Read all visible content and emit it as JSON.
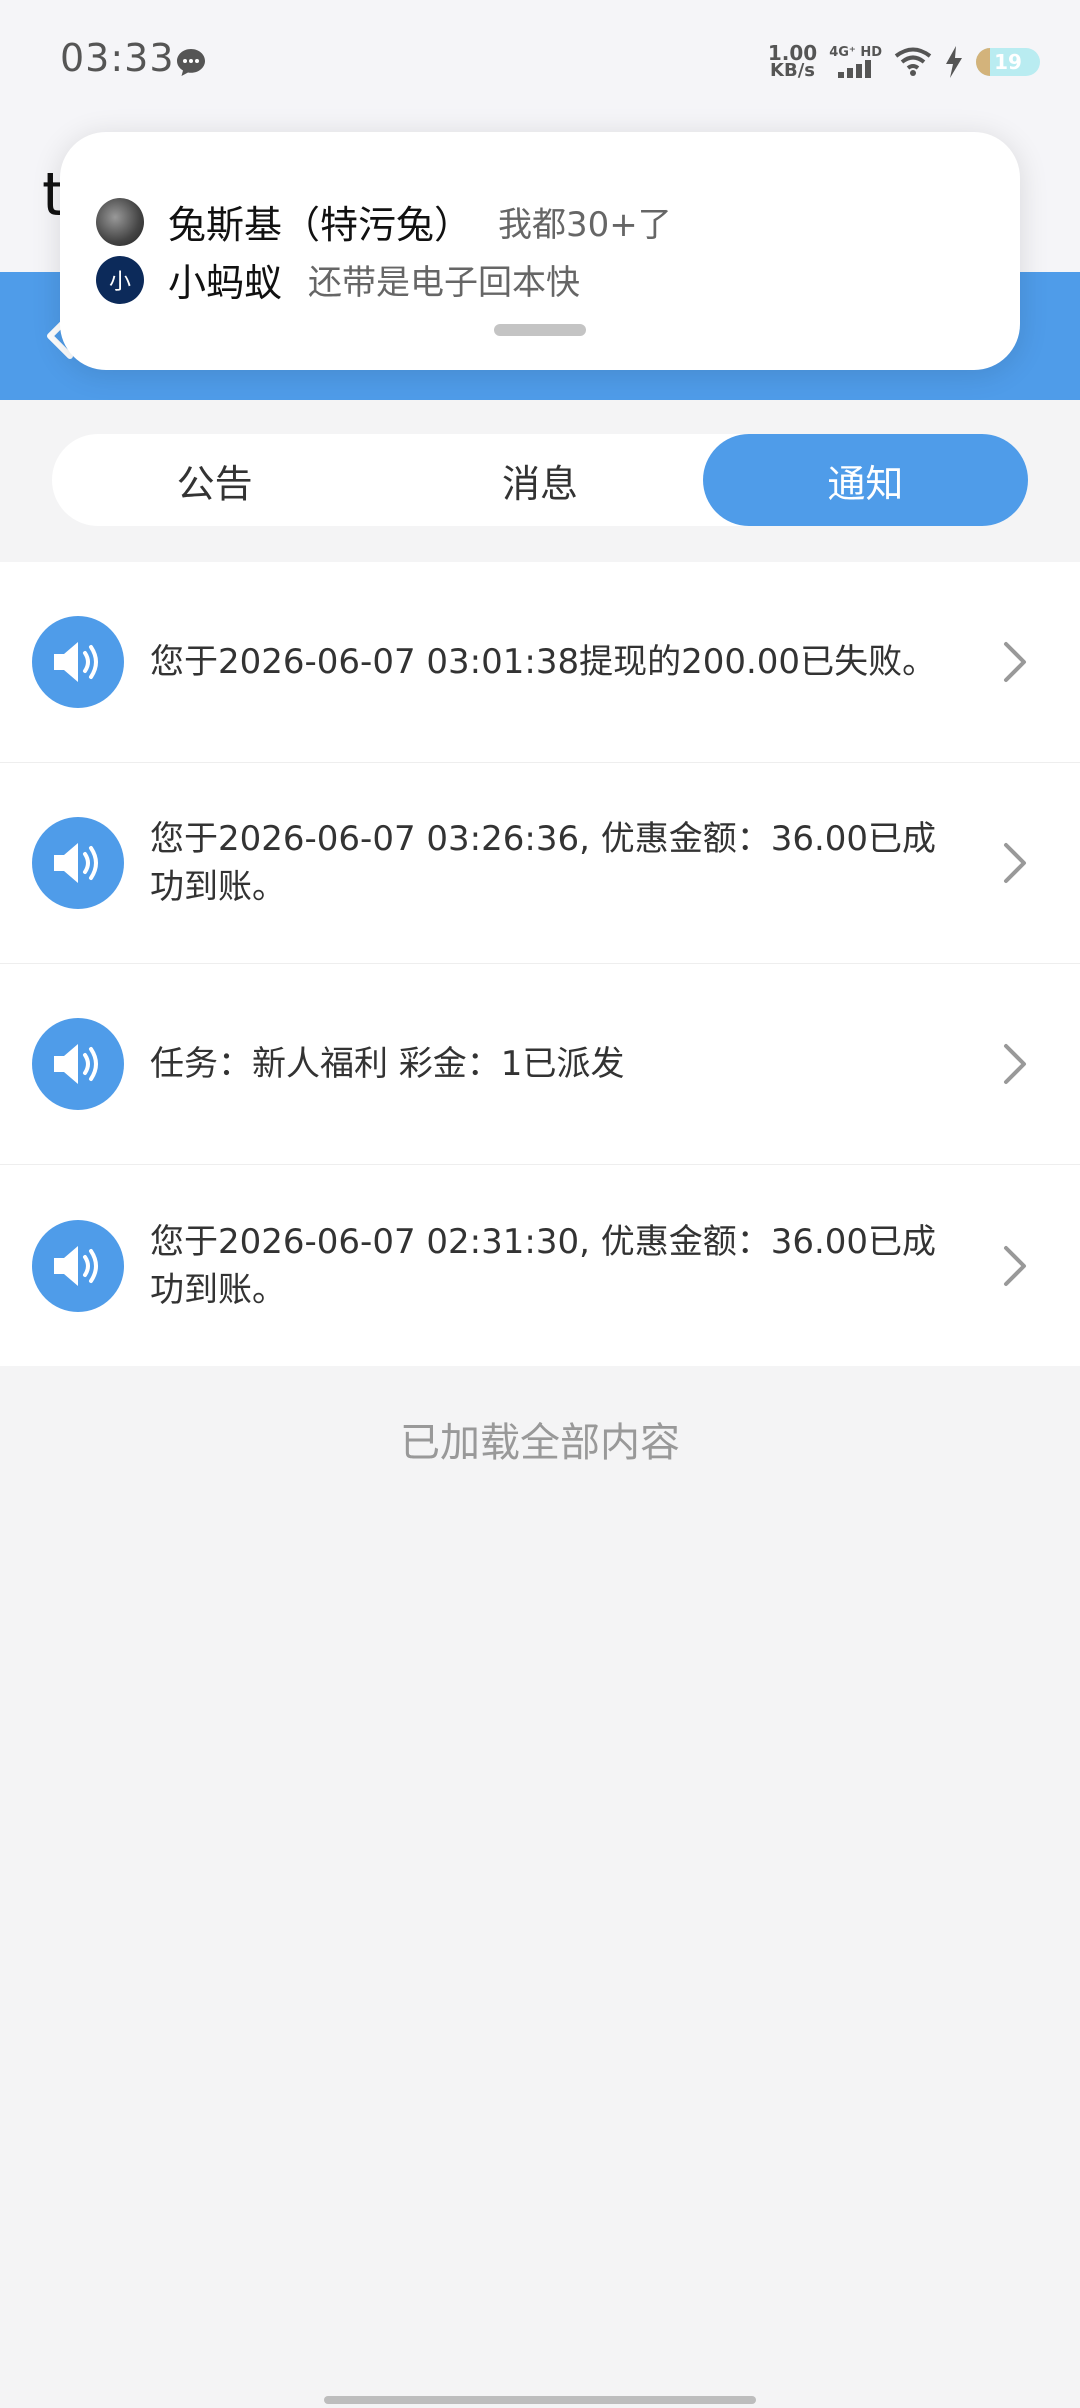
{
  "status_bar": {
    "time": "03:33",
    "net_speed_value": "1.00",
    "net_speed_unit": "KB/s",
    "signal_label": "4G⁺ HD",
    "battery": "19"
  },
  "app": {
    "title_peek": "t"
  },
  "popup": {
    "row1": {
      "name": "兔斯基（特污兔）",
      "text": "我都30+了"
    },
    "row2": {
      "avatar_char": "小",
      "name": "小蚂蚁",
      "text": "还带是电子回本快"
    }
  },
  "tabs": [
    {
      "label": "公告"
    },
    {
      "label": "消息"
    },
    {
      "label": "通知",
      "active": true
    }
  ],
  "notifications": [
    {
      "text": "您于2026-06-07 03:01:38提现的200.00已失败。"
    },
    {
      "text": "您于2026-06-07 03:26:36, 优惠金额：36.00已成功到账。"
    },
    {
      "text": "任务：新人福利 彩金：1已派发"
    },
    {
      "text": "您于2026-06-07 02:31:30, 优惠金额：36.00已成功到账。"
    }
  ],
  "footer": {
    "loaded_all": "已加载全部内容"
  },
  "colors": {
    "accent": "#4f9ce9",
    "background": "#f4f4f5"
  }
}
